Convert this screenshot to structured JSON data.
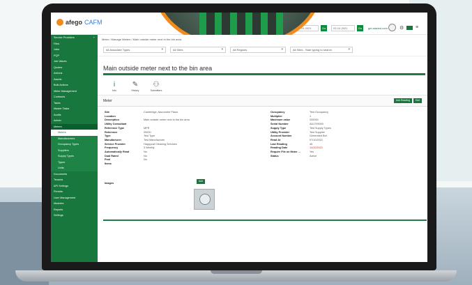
{
  "app": {
    "brand_prefix": "afego",
    "brand_suffix": "CAFM"
  },
  "topbar": {
    "site_select": "Site: Quick Actions",
    "date_from": "02-10-2021",
    "date_to": "03-10-2021",
    "go_label": "Go",
    "support_label": "get-started.com"
  },
  "sidebar": {
    "items": [
      {
        "label": "Service Providers",
        "has_plus": true,
        "kind": "top"
      },
      {
        "label": "Files",
        "kind": "top"
      },
      {
        "label": "Jobs",
        "kind": "top"
      },
      {
        "label": "PQP",
        "kind": "top"
      },
      {
        "label": "Job Values",
        "kind": "top"
      },
      {
        "label": "Quotes",
        "kind": "top"
      },
      {
        "label": "Actions",
        "kind": "top"
      },
      {
        "label": "Assets",
        "kind": "top"
      },
      {
        "label": "Bulk Actions",
        "kind": "top"
      },
      {
        "label": "Meter Management",
        "kind": "top"
      },
      {
        "label": "Contracts",
        "kind": "top"
      },
      {
        "label": "Tasks",
        "kind": "top"
      },
      {
        "label": "Master Tasks",
        "kind": "top"
      },
      {
        "label": "Audits",
        "kind": "top"
      },
      {
        "label": "Admin",
        "kind": "top"
      },
      {
        "label": "Meters",
        "kind": "top",
        "active": true
      },
      {
        "label": "Meters",
        "kind": "sub",
        "active": true
      },
      {
        "label": "Manufacturers",
        "kind": "sub"
      },
      {
        "label": "Occupancy Types",
        "kind": "sub"
      },
      {
        "label": "Suppliers",
        "kind": "sub"
      },
      {
        "label": "Supply Types",
        "kind": "sub"
      },
      {
        "label": "Types",
        "kind": "sub"
      },
      {
        "label": "Units",
        "kind": "sub"
      },
      {
        "label": "Documents",
        "kind": "top"
      },
      {
        "label": "Tenants",
        "kind": "top"
      },
      {
        "label": "API Settings",
        "kind": "top"
      },
      {
        "label": "Permits",
        "kind": "top"
      },
      {
        "label": "User Management",
        "kind": "top"
      },
      {
        "label": "Modules",
        "kind": "top"
      },
      {
        "label": "Reports",
        "kind": "top"
      },
      {
        "label": "Settings",
        "kind": "top"
      }
    ]
  },
  "breadcrumb": "Meter / Manage Meters / Main outside meter next to the bin area",
  "filters": [
    "All Associate Types",
    "All Sites",
    "All Regions",
    "All Sites - Start typing to search"
  ],
  "page_title": "Main outside meter next to the bin area",
  "tabs": [
    {
      "label": "Info",
      "icon": "info-icon"
    },
    {
      "label": "History",
      "icon": "edit-icon"
    },
    {
      "label": "Submitters",
      "icon": "users-icon"
    }
  ],
  "section": {
    "label": "Meter",
    "actions": [
      "Add Reading",
      "Edit"
    ]
  },
  "details_left": [
    {
      "k": "Site",
      "v": "Cambridge, Narcombe Plaza"
    },
    {
      "k": "Location",
      "v": ""
    },
    {
      "k": "Description",
      "v": "Main outside meter next to the bin area"
    },
    {
      "k": "Utility Consultant",
      "v": ""
    },
    {
      "k": "Reference Type",
      "v": "MPR"
    },
    {
      "k": "Reference",
      "v": "09000"
    },
    {
      "k": "Type",
      "v": "Test Type"
    },
    {
      "k": "Manufacturer",
      "v": "Test Manufacturer"
    },
    {
      "k": "Service Provider",
      "v": "Happycat Cleaning Services"
    },
    {
      "k": "Frequency",
      "v": "3 Weekly"
    },
    {
      "k": "Automatically Read",
      "v": "No"
    },
    {
      "k": "Dual Rated",
      "v": "No"
    },
    {
      "k": "Pool",
      "v": "No"
    },
    {
      "k": "Items",
      "v": ""
    }
  ],
  "details_right": [
    {
      "k": "Occupancy",
      "v": "Test Occupancy"
    },
    {
      "k": "Multiplier",
      "v": "1"
    },
    {
      "k": "Maximum value",
      "v": "200000"
    },
    {
      "k": "Serial Number",
      "v": "AA1709000"
    },
    {
      "k": "Supply Type",
      "v": "Test Supply Types"
    },
    {
      "k": "Utility Provider",
      "v": "Test Supplier"
    },
    {
      "k": "Account Number",
      "v": "Generated Bot"
    },
    {
      "k": "Read At",
      "v": "07/10/2021"
    },
    {
      "k": "Last Reading",
      "v": "45"
    },
    {
      "k": "Reading Date",
      "v": "14/10/2021",
      "red": true
    },
    {
      "k": "Require File on Meter ...",
      "v": "Yes"
    },
    {
      "k": "Status",
      "v": "Active"
    }
  ],
  "images": {
    "label": "Images",
    "add_label": "Add"
  },
  "colors": {
    "brand_green": "#17773c",
    "accent_orange": "#f08b1c"
  }
}
